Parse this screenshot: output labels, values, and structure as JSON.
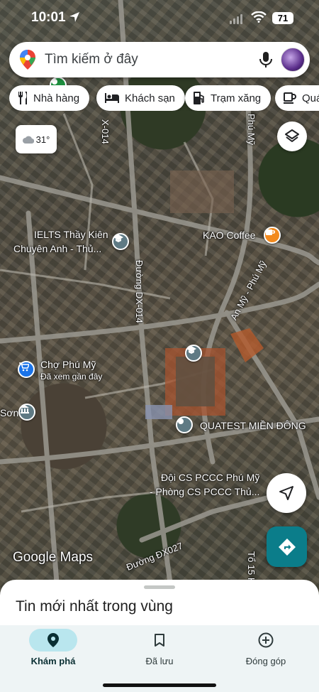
{
  "status_bar": {
    "time": "10:01",
    "battery": "71"
  },
  "search": {
    "placeholder": "Tìm kiếm ở đây"
  },
  "chips": [
    {
      "label": "Nhà hàng",
      "icon": "restaurant-icon"
    },
    {
      "label": "Khách sạn",
      "icon": "hotel-icon"
    },
    {
      "label": "Trạm xăng",
      "icon": "gas-station-icon"
    },
    {
      "label": "Quá",
      "icon": "coffee-icon"
    }
  ],
  "weather": {
    "temp": "31°",
    "icon": "cloud-icon"
  },
  "map_labels": {
    "dx_top": "X-014",
    "phu_my_top": "Phú Mỹ",
    "ielts_line1": "IELTS Thầy Kiên",
    "ielts_line2": "Chuyên Anh - Thủ...",
    "kao_coffee": "KAO Coffee",
    "an_my_phu_my": "An Mỹ - Phú Mỹ",
    "duong_dx014": "Đường DX-014",
    "cho_phu_my": "Chợ Phú Mỹ",
    "cho_phu_my_sub": "Đã xem gần đây",
    "son": "Sơn",
    "quatest": "QUATEST MIỀN ĐÔNG",
    "pccc_line1": "Đội CS PCCC Phú Mỹ",
    "pccc_line2": "- Phòng CS PCCC Thủ...",
    "duong_dx027": "Đường ĐX027",
    "to_15": "Tổ 15 K"
  },
  "google_logo": "Google Maps",
  "sheet": {
    "title": "Tin mới nhất trong vùng"
  },
  "nav": [
    {
      "label": "Khám phá",
      "icon": "explore-pin-icon",
      "active": true
    },
    {
      "label": "Đã lưu",
      "icon": "bookmark-icon",
      "active": false
    },
    {
      "label": "Đóng góp",
      "icon": "add-circle-icon",
      "active": false
    }
  ],
  "colors": {
    "accent": "#0b7d8a",
    "nav_active_bg": "#b9e6ee",
    "coffee_poi": "#f28a1e",
    "market_poi": "#1a73e8",
    "school_poi": "#5f7a84"
  }
}
